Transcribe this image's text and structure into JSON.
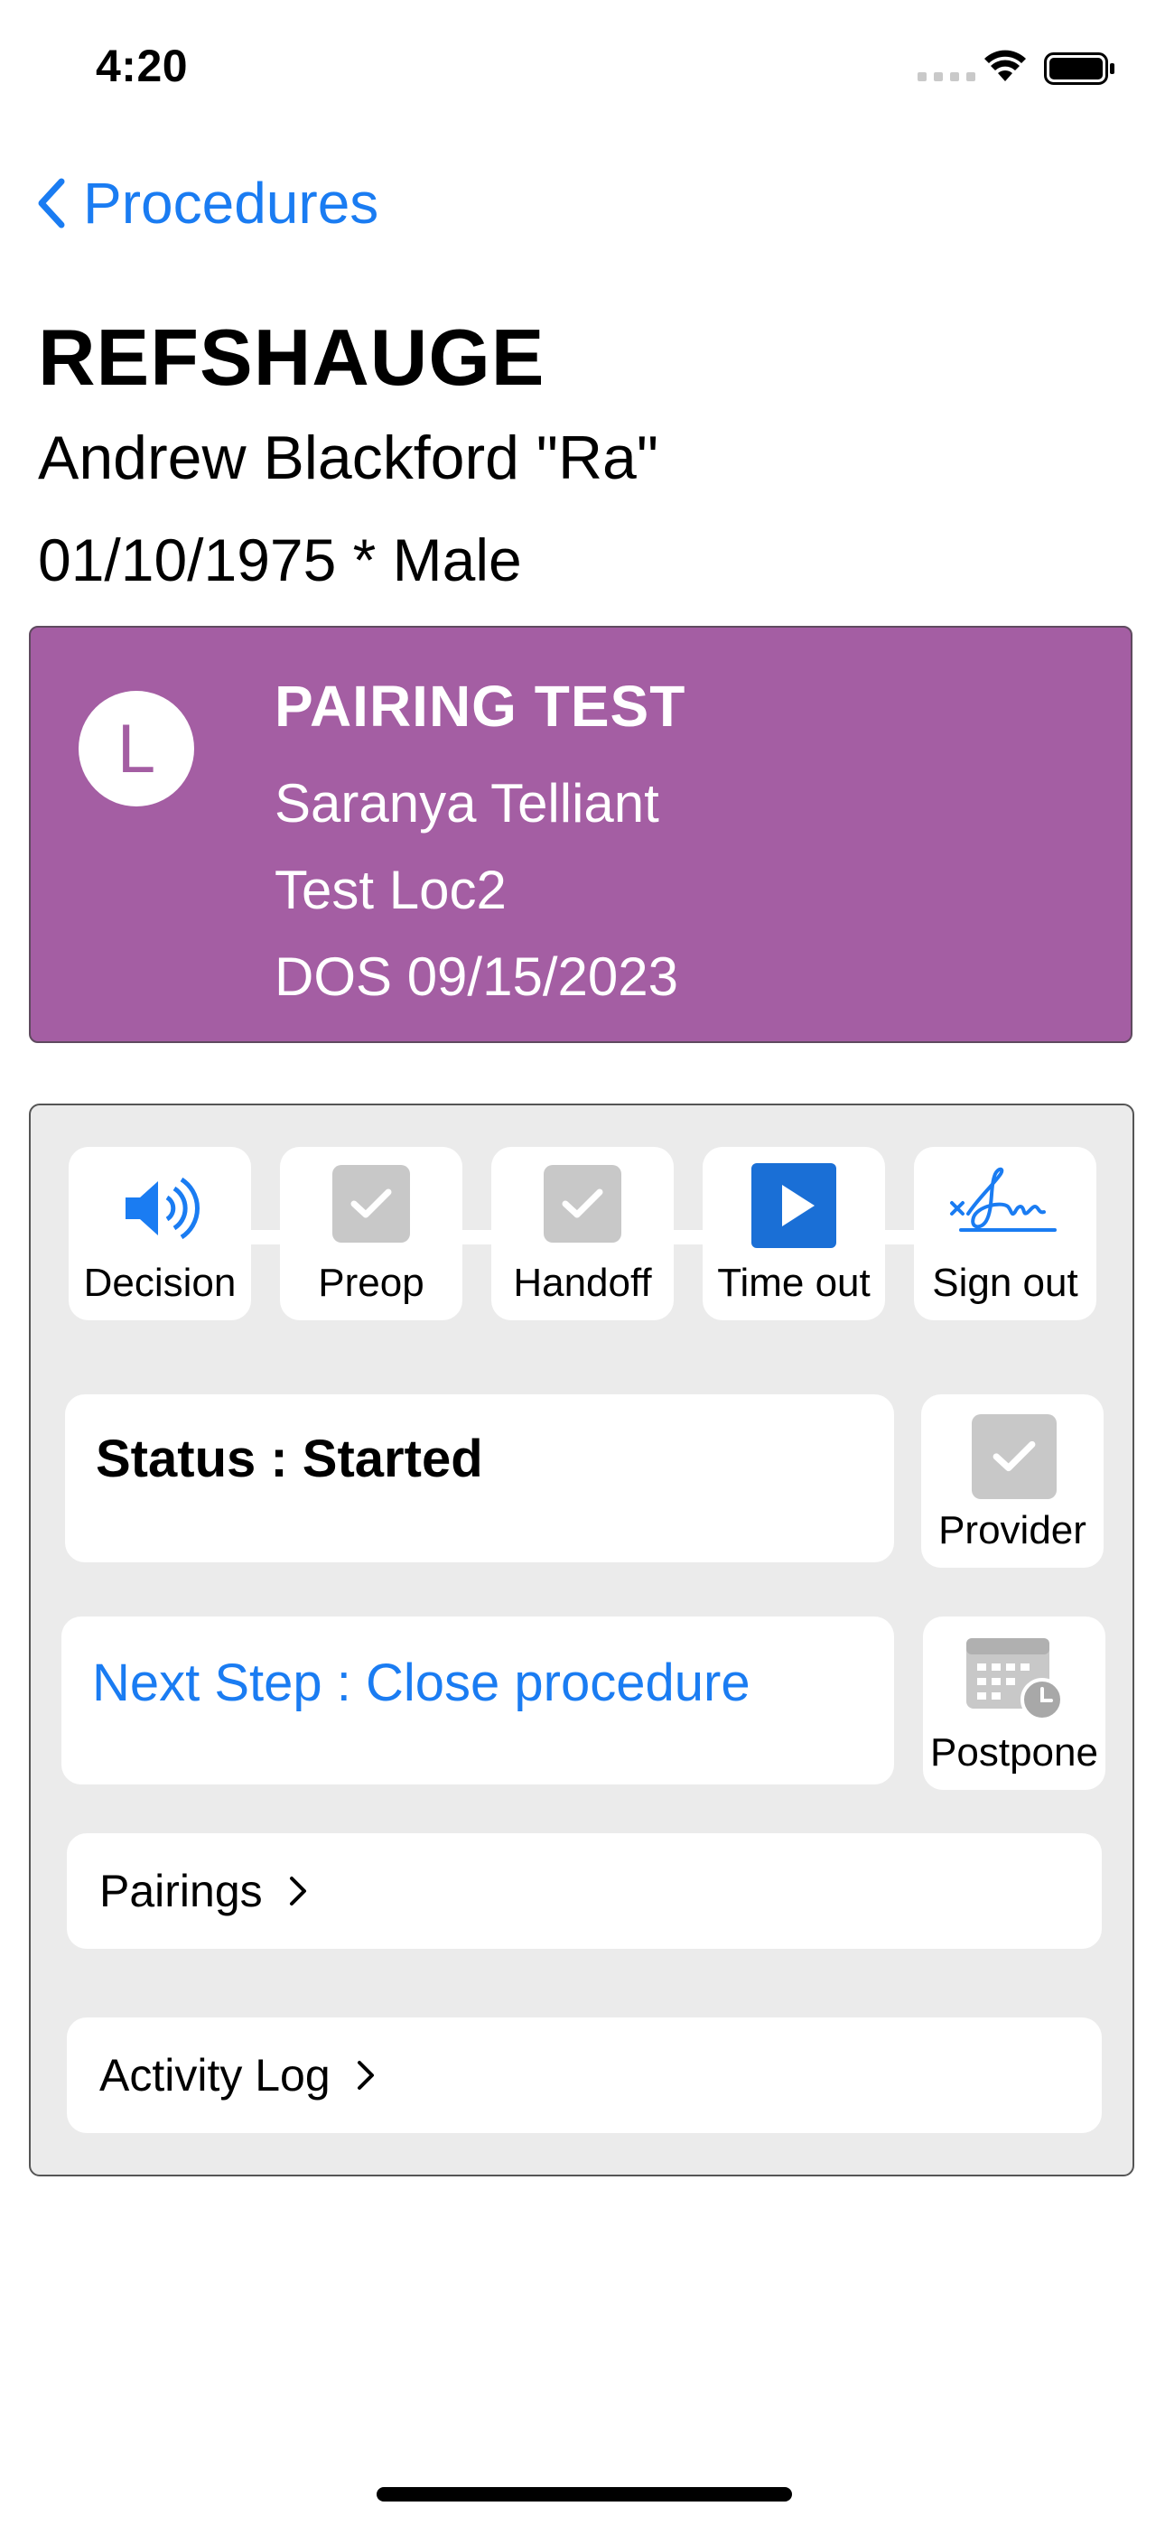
{
  "status_bar": {
    "time": "4:20"
  },
  "nav": {
    "back_label": "Procedures"
  },
  "patient": {
    "last_name": "REFSHAUGE",
    "first_name": "Andrew Blackford \"Ra\"",
    "dob_sex": "01/10/1975 * Male"
  },
  "procedure": {
    "avatar_letter": "L",
    "name": "PAIRING TEST",
    "provider": "Saranya Telliant",
    "location": "Test Loc2",
    "dos": "DOS 09/15/2023",
    "card_color": "#a45ea3"
  },
  "steps": [
    {
      "label": "Decision",
      "icon": "speaker-icon"
    },
    {
      "label": "Preop",
      "icon": "checkbox-checked-icon"
    },
    {
      "label": "Handoff",
      "icon": "checkbox-checked-icon"
    },
    {
      "label": "Time out",
      "icon": "play-icon"
    },
    {
      "label": "Sign out",
      "icon": "signature-icon"
    }
  ],
  "status": {
    "text": "Status : Started"
  },
  "provider_button": {
    "label": "Provider",
    "icon": "checkbox-checked-icon"
  },
  "next_step": {
    "text": "Next Step : Close procedure"
  },
  "postpone_button": {
    "label": "Postpone",
    "icon": "calendar-clock-icon"
  },
  "links": [
    {
      "label": "Pairings"
    },
    {
      "label": "Activity Log"
    }
  ],
  "colors": {
    "accent": "#1a7cf2",
    "panel_bg": "#ebebeb"
  }
}
